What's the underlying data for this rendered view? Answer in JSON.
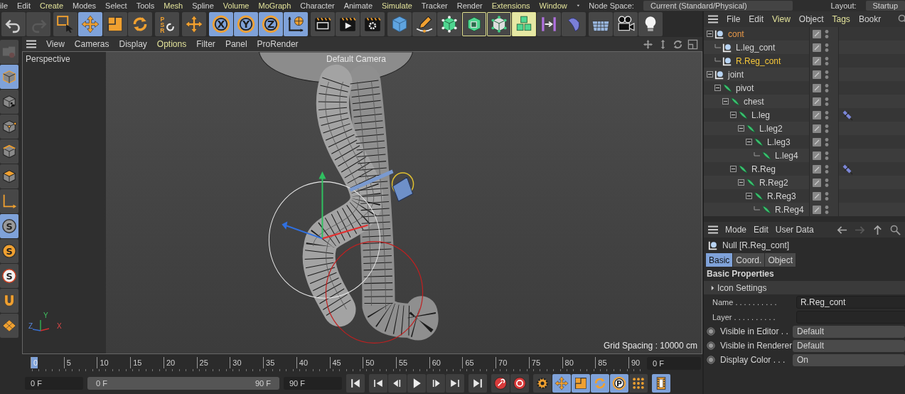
{
  "menu_bar": {
    "items": [
      {
        "label": "ile",
        "highlighted": false
      },
      {
        "label": "Edit",
        "highlighted": false
      },
      {
        "label": "Create",
        "highlighted": true
      },
      {
        "label": "Modes",
        "highlighted": false
      },
      {
        "label": "Select",
        "highlighted": false
      },
      {
        "label": "Tools",
        "highlighted": false
      },
      {
        "label": "Mesh",
        "highlighted": true
      },
      {
        "label": "Spline",
        "highlighted": false
      },
      {
        "label": "Volume",
        "highlighted": true
      },
      {
        "label": "MoGraph",
        "highlighted": true
      },
      {
        "label": "Character",
        "highlighted": false
      },
      {
        "label": "Animate",
        "highlighted": false
      },
      {
        "label": "Simulate",
        "highlighted": true
      },
      {
        "label": "Tracker",
        "highlighted": false
      },
      {
        "label": "Render",
        "highlighted": false
      },
      {
        "label": "Extensions",
        "highlighted": true
      },
      {
        "label": "Window",
        "highlighted": true
      }
    ],
    "node_space": {
      "label": "Node Space:",
      "value": "Current (Standard/Physical)"
    },
    "layout": {
      "label": "Layout:",
      "value": "Startup"
    }
  },
  "main_toolbar": [
    [
      {
        "kind": "undo",
        "selected": false,
        "highlighted": false
      },
      {
        "kind": "redo",
        "selected": false,
        "highlighted": false
      }
    ],
    [
      {
        "kind": "live-select",
        "selected": false,
        "highlighted": false
      },
      {
        "kind": "move",
        "selected": true,
        "highlighted": false
      },
      {
        "kind": "scale",
        "selected": false,
        "highlighted": false
      },
      {
        "kind": "rotate",
        "selected": false,
        "highlighted": false
      }
    ],
    [
      {
        "kind": "psr",
        "selected": false,
        "highlighted": false,
        "label": "PSR"
      }
    ],
    [
      {
        "kind": "move",
        "selected": false,
        "highlighted": false
      }
    ],
    [
      {
        "kind": "axis",
        "selected": true,
        "highlighted": false,
        "label": "X"
      },
      {
        "kind": "axis",
        "selected": true,
        "highlighted": false,
        "label": "Y"
      },
      {
        "kind": "axis",
        "selected": true,
        "highlighted": false,
        "label": "Z"
      },
      {
        "kind": "world",
        "selected": true,
        "highlighted": false
      }
    ],
    [
      {
        "kind": "render-view",
        "selected": false,
        "highlighted": false
      },
      {
        "kind": "render",
        "selected": false,
        "highlighted": false
      },
      {
        "kind": "render-settings",
        "selected": false,
        "highlighted": false
      }
    ],
    [
      {
        "kind": "cube",
        "selected": false,
        "highlighted": false
      },
      {
        "kind": "pen",
        "selected": false,
        "highlighted": false
      },
      {
        "kind": "subdivision",
        "selected": false,
        "highlighted": false
      },
      {
        "kind": "extrude",
        "selected": false,
        "highlighted": true
      },
      {
        "kind": "vertex-cube",
        "selected": false,
        "highlighted": true
      },
      {
        "kind": "cloner",
        "selected": false,
        "highlighted": true
      },
      {
        "kind": "symmetry",
        "selected": false,
        "highlighted": false
      },
      {
        "kind": "deformer",
        "selected": false,
        "highlighted": false
      }
    ],
    [
      {
        "kind": "floor",
        "selected": false,
        "highlighted": false
      },
      {
        "kind": "camera",
        "selected": false,
        "highlighted": false
      },
      {
        "kind": "light",
        "selected": false,
        "highlighted": false
      }
    ]
  ],
  "side_toolbar": [
    {
      "kind": "model",
      "selected": false
    },
    {
      "kind": "object-mode",
      "selected": true
    },
    {
      "kind": "texture",
      "selected": false
    },
    {
      "kind": "points",
      "selected": false
    },
    {
      "kind": "edges",
      "selected": false
    },
    {
      "kind": "polygons",
      "selected": false
    },
    {
      "kind": "axis-mode",
      "selected": false
    },
    {
      "kind": "snap",
      "selected": true,
      "label": "S"
    },
    {
      "kind": "snap-orange",
      "selected": false,
      "label": "S"
    },
    {
      "kind": "snap-ring",
      "selected": false,
      "label": "S"
    },
    {
      "kind": "magnet",
      "selected": false
    },
    {
      "kind": "workplane",
      "selected": false
    }
  ],
  "viewport": {
    "menu": [
      {
        "label": "View",
        "highlighted": false
      },
      {
        "label": "Cameras",
        "highlighted": false
      },
      {
        "label": "Display",
        "highlighted": false
      },
      {
        "label": "Options",
        "highlighted": true
      },
      {
        "label": "Filter",
        "highlighted": false
      },
      {
        "label": "Panel",
        "highlighted": false
      },
      {
        "label": "ProRender",
        "highlighted": false
      }
    ],
    "view_name": "Perspective",
    "camera": "Default Camera",
    "grid_spacing": "Grid Spacing : 10000 cm",
    "axis_labels": {
      "y": "Y",
      "z": "Z",
      "x": "X"
    }
  },
  "timeline": {
    "ruler": [
      {
        "label": "0",
        "selected": true
      },
      {
        "label": "5",
        "selected": false
      },
      {
        "label": "10",
        "selected": false
      },
      {
        "label": "15",
        "selected": false
      },
      {
        "label": "20",
        "selected": false
      },
      {
        "label": "25",
        "selected": false
      },
      {
        "label": "30",
        "selected": false
      },
      {
        "label": "35",
        "selected": false
      },
      {
        "label": "40",
        "selected": false
      },
      {
        "label": "45",
        "selected": false
      },
      {
        "label": "50",
        "selected": false
      },
      {
        "label": "55",
        "selected": false
      },
      {
        "label": "60",
        "selected": false
      },
      {
        "label": "65",
        "selected": false
      },
      {
        "label": "70",
        "selected": false
      },
      {
        "label": "75",
        "selected": false
      },
      {
        "label": "80",
        "selected": false
      },
      {
        "label": "85",
        "selected": false
      },
      {
        "label": "90",
        "selected": false
      }
    ],
    "current_field": "0 F",
    "start_field": "0 F",
    "range": {
      "start": "0 F",
      "end": "90 F",
      "level": 1
    },
    "end_field": "90 F",
    "controls": [
      [
        {
          "kind": "last-start",
          "selected": false
        }
      ],
      [
        {
          "kind": "prev-key",
          "selected": false
        },
        {
          "kind": "prev-frame",
          "selected": false
        },
        {
          "kind": "play",
          "selected": false
        },
        {
          "kind": "next-frame",
          "selected": false
        },
        {
          "kind": "next-key",
          "selected": false
        }
      ],
      [
        {
          "kind": "last-end",
          "selected": false
        }
      ],
      [
        {
          "kind": "record",
          "selected": false
        },
        {
          "kind": "autokey",
          "selected": false
        }
      ],
      [
        {
          "kind": "gear",
          "selected": false
        },
        {
          "kind": "move",
          "selected": true
        },
        {
          "kind": "scale",
          "selected": true
        },
        {
          "kind": "rotate",
          "selected": true
        },
        {
          "kind": "param",
          "selected": true,
          "label": "P"
        },
        {
          "kind": "dots",
          "selected": false
        }
      ],
      [
        {
          "kind": "film",
          "selected": true
        }
      ]
    ]
  },
  "object_manager": {
    "menu": [
      {
        "label": "File",
        "highlighted": false
      },
      {
        "label": "Edit",
        "highlighted": false
      },
      {
        "label": "View",
        "highlighted": true
      },
      {
        "label": "Object",
        "highlighted": false
      },
      {
        "label": "Tags",
        "highlighted": true
      },
      {
        "label": "Bookr",
        "highlighted": false
      }
    ],
    "tree": [
      {
        "name": "cont",
        "kind": "null",
        "expanded": true,
        "active": true,
        "selected": false,
        "has_tag": false,
        "children": [
          {
            "name": "L.leg_cont",
            "kind": "null",
            "active": false,
            "selected": false,
            "has_tag": false
          },
          {
            "name": "R.Reg_cont",
            "kind": "null",
            "active": false,
            "selected": true,
            "has_tag": false
          }
        ]
      },
      {
        "name": "joint",
        "kind": "null",
        "expanded": true,
        "active": false,
        "selected": false,
        "has_tag": false,
        "children": [
          {
            "name": "pivot",
            "kind": "joint",
            "expanded": true,
            "active": false,
            "selected": false,
            "has_tag": false,
            "children": [
              {
                "name": "chest",
                "kind": "joint",
                "expanded": true,
                "active": false,
                "selected": false,
                "has_tag": false,
                "children": [
                  {
                    "name": "L.leg",
                    "kind": "joint",
                    "expanded": true,
                    "active": false,
                    "selected": false,
                    "has_tag": true,
                    "children": [
                      {
                        "name": "L.leg2",
                        "kind": "joint",
                        "expanded": true,
                        "active": false,
                        "selected": false,
                        "has_tag": false,
                        "children": [
                          {
                            "name": "L.leg3",
                            "kind": "joint",
                            "expanded": true,
                            "active": false,
                            "selected": false,
                            "has_tag": false,
                            "children": [
                              {
                                "name": "L.leg4",
                                "kind": "joint",
                                "active": false,
                                "selected": false,
                                "has_tag": false
                              }
                            ]
                          }
                        ]
                      }
                    ]
                  },
                  {
                    "name": "R.Reg",
                    "kind": "joint",
                    "expanded": true,
                    "active": false,
                    "selected": false,
                    "has_tag": true,
                    "children": [
                      {
                        "name": "R.Reg2",
                        "kind": "joint",
                        "expanded": true,
                        "active": false,
                        "selected": false,
                        "has_tag": false,
                        "children": [
                          {
                            "name": "R.Reg3",
                            "kind": "joint",
                            "expanded": true,
                            "active": false,
                            "selected": false,
                            "has_tag": false,
                            "children": [
                              {
                                "name": "R.Reg4",
                                "kind": "joint",
                                "active": false,
                                "selected": false,
                                "has_tag": false
                              }
                            ]
                          }
                        ]
                      }
                    ]
                  }
                ]
              }
            ]
          }
        ]
      }
    ]
  },
  "attributes": {
    "menu": [
      {
        "label": "Mode"
      },
      {
        "label": "Edit"
      },
      {
        "label": "User Data"
      }
    ],
    "title": "Null [R.Reg_cont]",
    "tabs": [
      {
        "label": "Basic",
        "selected": true
      },
      {
        "label": "Coord.",
        "selected": false
      },
      {
        "label": "Object",
        "selected": false
      }
    ],
    "heading": "Basic Properties",
    "section": {
      "label": "Icon Settings",
      "expanded": false
    },
    "fields": [
      {
        "label": "Name . . . . . . . . . .",
        "value": "R.Reg_cont"
      },
      {
        "label": "Layer . . . . . . . . . ."
      }
    ],
    "options": [
      {
        "label": "Visible in Editor . .",
        "value": "Default"
      },
      {
        "label": "Visible in Renderer",
        "value": "Default"
      },
      {
        "label": "Display Color . . .",
        "value": "On"
      }
    ]
  }
}
